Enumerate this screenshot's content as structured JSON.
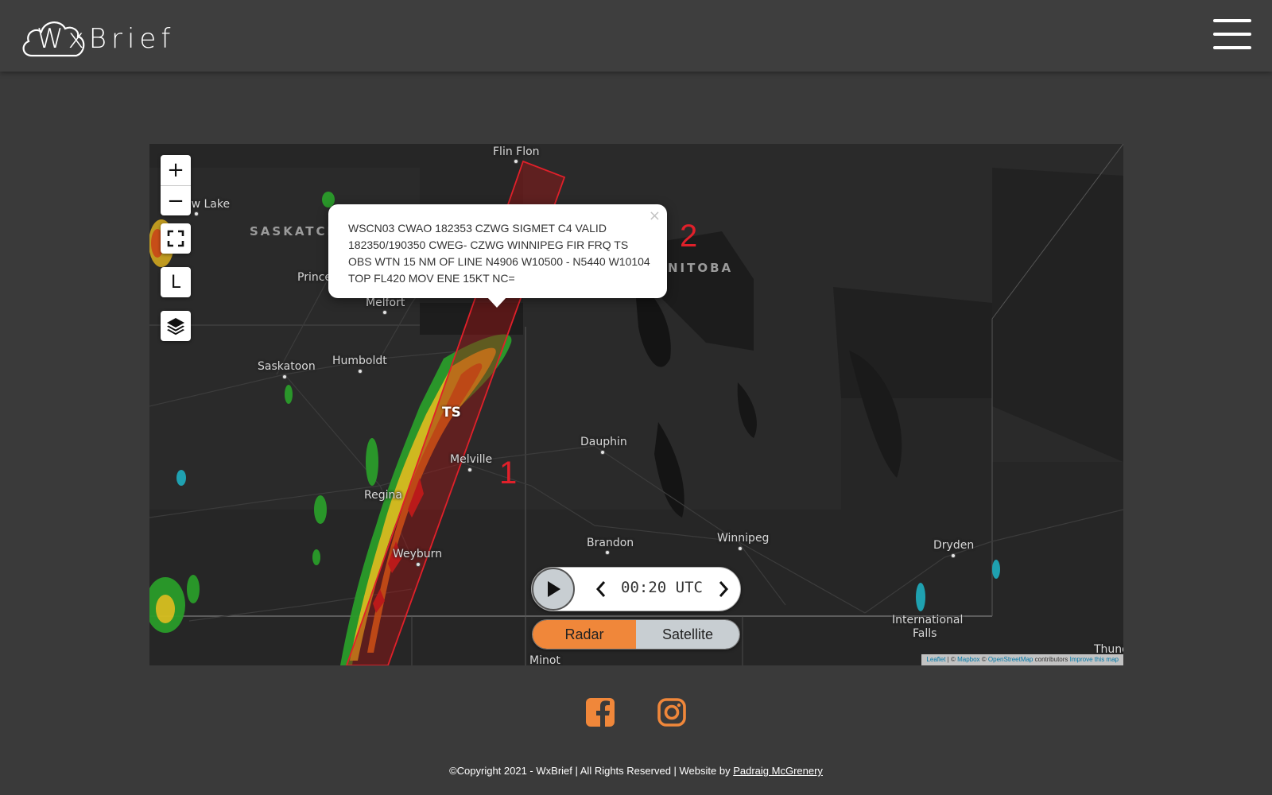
{
  "header": {
    "logo_text": "WxBrief",
    "menu_icon": "hamburger-menu-icon"
  },
  "map": {
    "controls": {
      "zoom_in": "+",
      "zoom_out": "−",
      "fullscreen_icon": "fullscreen-icon",
      "locate_label": "L",
      "layers_icon": "layers-icon"
    },
    "places": {
      "flin_flon": "Flin Flon",
      "meadow_lake": "ow Lake",
      "saskatchewan": "SASKATCH",
      "manitoba": "NITOBA",
      "prince_albert": "Prince",
      "melfort": "Melfort",
      "humboldt": "Humboldt",
      "saskatoon": "Saskatoon",
      "dauphin": "Dauphin",
      "melville": "Melville",
      "regina": "Regina",
      "brandon": "Brandon",
      "winnipeg": "Winnipeg",
      "weyburn": "Weyburn",
      "dryden": "Dryden",
      "intl_falls_1": "International",
      "intl_falls_2": "Falls",
      "thunder_bay": "Thund",
      "minot": "Minot"
    },
    "sigmet_labels": {
      "area_1": "1",
      "area_2": "2",
      "ts": "TS"
    },
    "popup": {
      "text": "WSCN03 CWAO 182353 CZWG SIGMET C4 VALID 182350/190350 CWEG- CZWG WINNIPEG FIR FRQ TS OBS WTN 15 NM OF LINE N4906 W10500 - N5440 W10104 TOP FL420 MOV ENE 15KT NC=",
      "close": "×"
    },
    "timeline": {
      "time": "00:20 UTC",
      "play_icon": "play-icon",
      "prev_icon": "chevron-left-icon",
      "next_icon": "chevron-right-icon"
    },
    "layers": {
      "radar": "Radar",
      "satellite": "Satellite",
      "active": "Radar"
    },
    "attribution": {
      "leaflet": "Leaflet",
      "sep1": " | © ",
      "mapbox": "Mapbox",
      "sep2": " © ",
      "osm": "OpenStreetMap",
      "contrib": " contributors ",
      "improve": "Improve this map"
    },
    "colors": {
      "sigmet": "#e0202a",
      "accent": "#f0873a"
    }
  },
  "social": {
    "facebook_icon": "facebook-icon",
    "instagram_icon": "instagram-icon"
  },
  "footer": {
    "copyright_symbol": "©",
    "text": "Copyright 2021 - WxBrief | All Rights Reserved | Website by ",
    "author": "Padraig McGrenery"
  }
}
